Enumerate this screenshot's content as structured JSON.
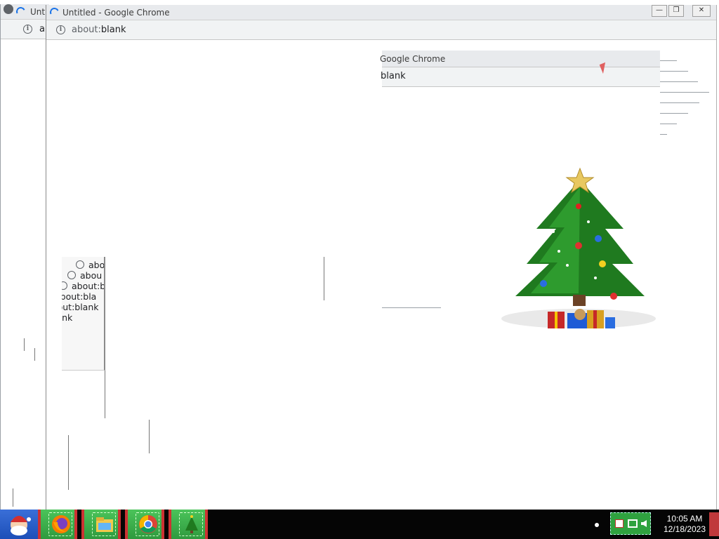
{
  "windows": {
    "back": {
      "title_fragment": "Unti",
      "url_fragment": "a"
    },
    "main": {
      "title": "Untitled - Google Chrome",
      "url_scheme": "about:",
      "url_rest": "blank"
    },
    "ghost": {
      "title_fragment": "Google Chrome",
      "url_fragment": "blank"
    }
  },
  "ghost_stack_rows": [
    "abou",
    "abou",
    "about:b",
    "about:bla",
    "about:blank",
    "ut:blank",
    "blank",
    "nk"
  ],
  "window_controls": {
    "minimize": "—",
    "restore": "❐",
    "close": "✕"
  },
  "taskbar": {
    "apps": [
      {
        "name": "Firefox",
        "icon": "firefox-icon"
      },
      {
        "name": "File Explorer",
        "icon": "file-explorer-icon"
      },
      {
        "name": "Google Chrome",
        "icon": "chrome-icon"
      },
      {
        "name": "Christmas Tree",
        "icon": "christmas-tree-icon"
      }
    ],
    "start_icon": "santa-icon",
    "clock": {
      "time": "10:05 AM",
      "date": "12/18/2023"
    },
    "tray_icons": [
      "network-icon",
      "volume-icon",
      "flag-icon"
    ]
  },
  "colors": {
    "chrome_accent": "#1a73e8",
    "taskbar_bg": "#050505",
    "taskbar_button": "#3cae4c",
    "taskbar_border": "#cc3333"
  }
}
